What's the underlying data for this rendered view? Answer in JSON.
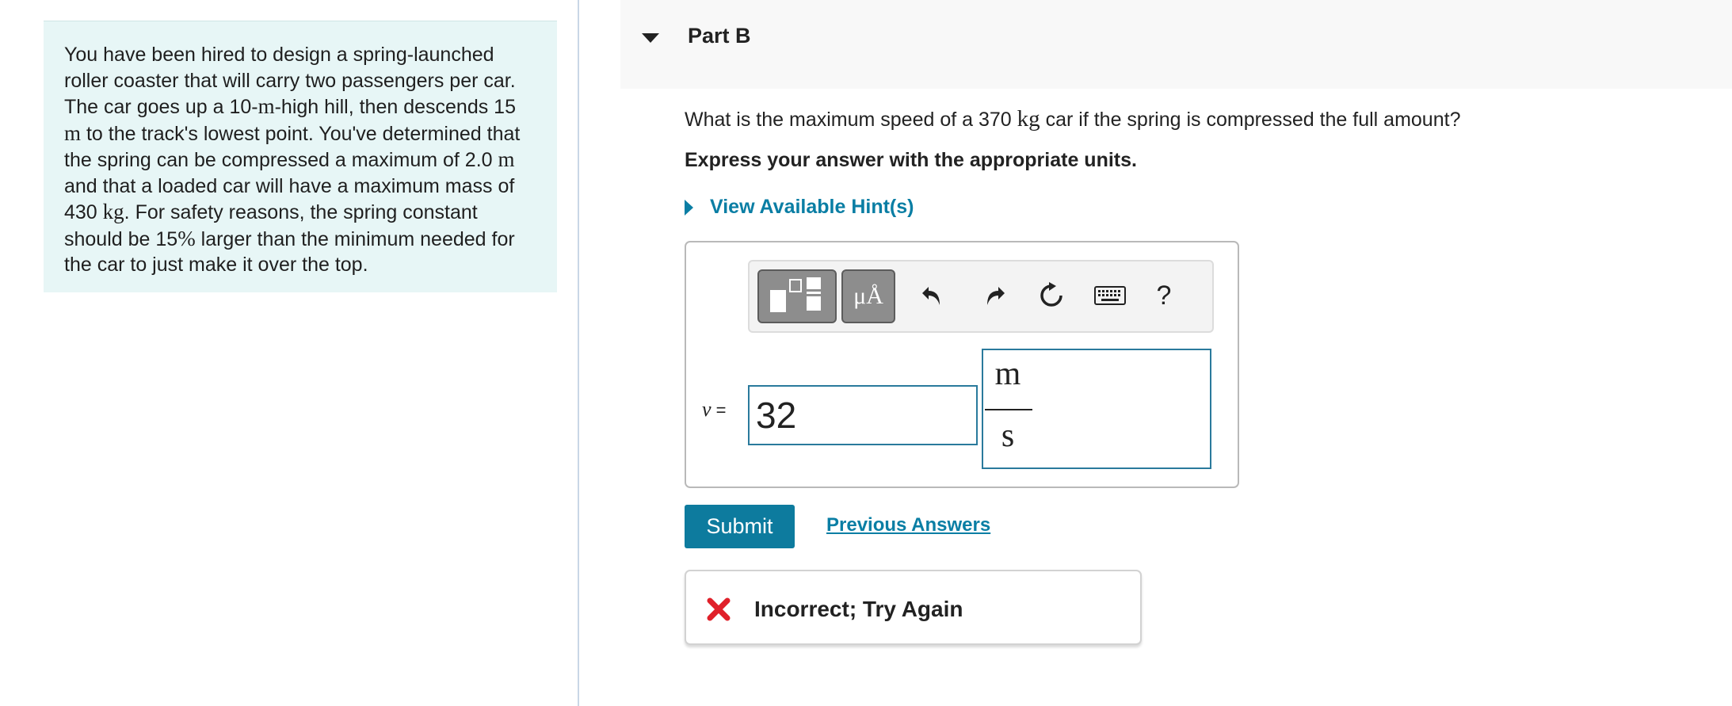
{
  "problem": {
    "segments": [
      {
        "t": "You have been hired to design a spring-launched roller coaster that will carry two passengers per car. The car goes up a 10-",
        "unit": false
      },
      {
        "t": "m",
        "unit": true
      },
      {
        "t": "-high hill, then descends 15 ",
        "unit": false
      },
      {
        "t": "m",
        "unit": true
      },
      {
        "t": " to the track's lowest point. You've determined that the spring can be compressed a maximum of 2.0 ",
        "unit": false
      },
      {
        "t": "m",
        "unit": true
      },
      {
        "t": " and that a loaded car will have a maximum mass of 430 ",
        "unit": false
      },
      {
        "t": "kg",
        "unit": true
      },
      {
        "t": ". For safety reasons, the spring constant should be 15",
        "unit": false
      },
      {
        "t": "%",
        "unit": true
      },
      {
        "t": " larger than the minimum needed for the car to just make it over the top.",
        "unit": false
      }
    ]
  },
  "part": {
    "title": "Part B",
    "question_pre": "What is the maximum speed of a 370 ",
    "question_unit": "kg",
    "question_post": " car if the spring is compressed the full amount?",
    "instruction": "Express your answer with the appropriate units.",
    "hint_label": "View Available Hint(s)"
  },
  "toolbar": {
    "units_glyph": "μÅ",
    "undo_icon": "undo-icon",
    "redo_icon": "redo-icon",
    "reset_icon": "reset-icon",
    "keyboard_icon": "keyboard-icon",
    "help_label": "?"
  },
  "answer": {
    "variable": "v",
    "equals": " =",
    "value": "32",
    "unit_numerator": "m",
    "unit_denominator": "s"
  },
  "actions": {
    "submit_label": "Submit",
    "previous_answers_label": "Previous Answers"
  },
  "feedback": {
    "status_icon": "x-mark-icon",
    "text": "Incorrect; Try Again",
    "icon_color": "#e0202a"
  },
  "colors": {
    "accent": "#0d7b9e",
    "problem_bg": "#e7f6f6",
    "input_border": "#2a7a9c"
  }
}
